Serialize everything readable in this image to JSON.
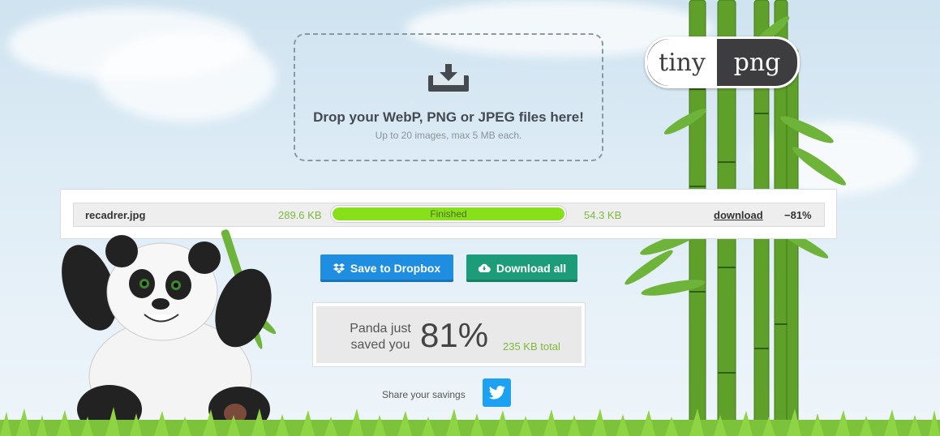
{
  "logo": {
    "left": "tiny",
    "right": "png"
  },
  "dropzone": {
    "title": "Drop your WebP, PNG or JPEG files here!",
    "subtitle": "Up to 20 images, max 5 MB each."
  },
  "results": {
    "rows": [
      {
        "filename": "recadrer.jpg",
        "original_size": "289.6 KB",
        "status": "Finished",
        "progress": 1.0,
        "new_size": "54.3 KB",
        "download_label": "download",
        "reduction": "−81%"
      }
    ]
  },
  "actions": {
    "dropbox_label": "Save to Dropbox",
    "download_all_label": "Download all"
  },
  "savings": {
    "label": "Panda just saved you",
    "percent": "81%",
    "total": "235 KB total"
  },
  "share": {
    "label": "Share your savings"
  },
  "colors": {
    "progress_fill": "#88e01b",
    "dropbox_button": "#1f8ee0",
    "download_button": "#1c9c79",
    "size_green": "#7cba3a",
    "twitter": "#1da1f2"
  }
}
